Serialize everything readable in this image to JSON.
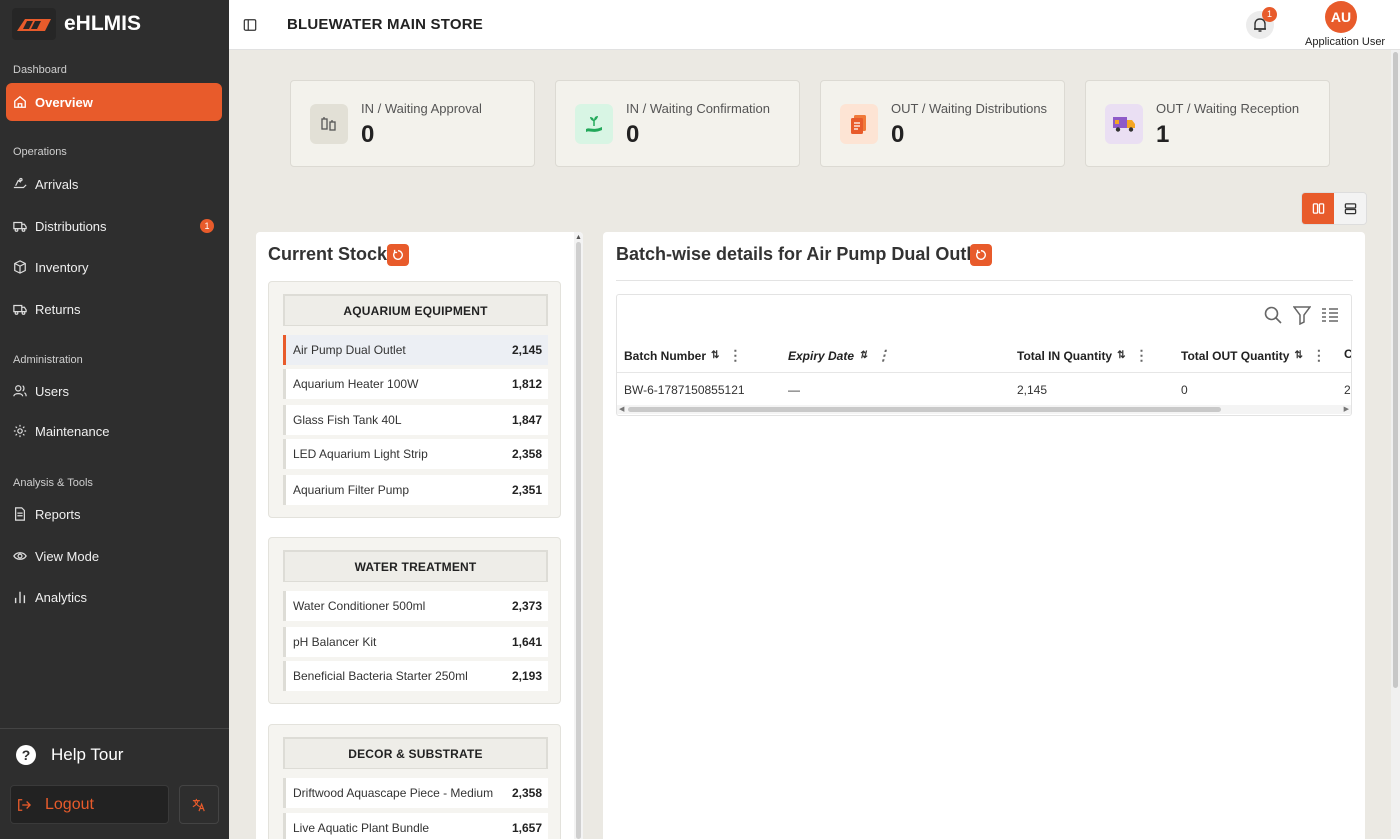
{
  "brand": {
    "name": "eHLMIS"
  },
  "sidebar": {
    "sections": [
      {
        "label": "Dashboard"
      },
      {
        "label": "Operations"
      },
      {
        "label": "Administration"
      },
      {
        "label": "Analysis & Tools"
      }
    ],
    "items": [
      {
        "label": "Overview",
        "icon": "home-icon"
      },
      {
        "label": "Arrivals",
        "icon": "arrivals-icon"
      },
      {
        "label": "Distributions",
        "icon": "truck-icon",
        "badge": "1"
      },
      {
        "label": "Inventory",
        "icon": "box-icon"
      },
      {
        "label": "Returns",
        "icon": "return-truck-icon"
      },
      {
        "label": "Users",
        "icon": "users-icon"
      },
      {
        "label": "Maintenance",
        "icon": "gear-icon"
      },
      {
        "label": "Reports",
        "icon": "document-icon"
      },
      {
        "label": "View Mode",
        "icon": "eye-icon"
      },
      {
        "label": "Analytics",
        "icon": "bar-chart-icon"
      }
    ],
    "help_tour": "Help Tour",
    "logout": "Logout"
  },
  "header": {
    "store_title": "BLUEWATER MAIN STORE",
    "notification_count": "1",
    "avatar_initials": "AU",
    "user_name": "Application User"
  },
  "cards": [
    {
      "label": "IN / Waiting Approval",
      "value": "0",
      "icon": "approval-icon",
      "icon_bg": "#e2e0d6"
    },
    {
      "label": "IN / Waiting Confirmation",
      "value": "0",
      "icon": "hand-plant-icon",
      "icon_bg": "#d8f5e4"
    },
    {
      "label": "OUT / Waiting Distributions",
      "value": "0",
      "icon": "clipboard-icon",
      "icon_bg": "#fde4d4"
    },
    {
      "label": "OUT / Waiting Reception",
      "value": "1",
      "icon": "delivery-truck-icon",
      "icon_bg": "#eadff3"
    }
  ],
  "stock": {
    "title": "Current Stock",
    "groups": [
      {
        "name": "AQUARIUM EQUIPMENT",
        "items": [
          {
            "name": "Air Pump Dual Outlet",
            "qty": "2,145"
          },
          {
            "name": "Aquarium Heater 100W",
            "qty": "1,812"
          },
          {
            "name": "Glass Fish Tank 40L",
            "qty": "1,847"
          },
          {
            "name": "LED Aquarium Light Strip",
            "qty": "2,358"
          },
          {
            "name": "Aquarium Filter Pump",
            "qty": "2,351"
          }
        ]
      },
      {
        "name": "WATER TREATMENT",
        "items": [
          {
            "name": "Water Conditioner 500ml",
            "qty": "2,373"
          },
          {
            "name": "pH Balancer Kit",
            "qty": "1,641"
          },
          {
            "name": "Beneficial Bacteria Starter 250ml",
            "qty": "2,193"
          }
        ]
      },
      {
        "name": "DECOR & SUBSTRATE",
        "items": [
          {
            "name": "Driftwood Aquascape Piece - Medium",
            "qty": "2,358"
          },
          {
            "name": "Live Aquatic Plant Bundle",
            "qty": "1,657"
          }
        ]
      }
    ]
  },
  "batch": {
    "title": "Batch-wise details for Air Pump Dual Outlet",
    "columns": [
      "Batch Number",
      "Expiry Date",
      "Total IN Quantity",
      "Total OUT Quantity",
      "C"
    ],
    "rows": [
      {
        "batch_number": "BW-6-1787150855121",
        "expiry_date": "—",
        "total_in": "2,145",
        "total_out": "0",
        "extra": "2"
      }
    ]
  },
  "colors": {
    "accent": "#e85b2b",
    "sidebar_bg": "#2e2e2e"
  }
}
